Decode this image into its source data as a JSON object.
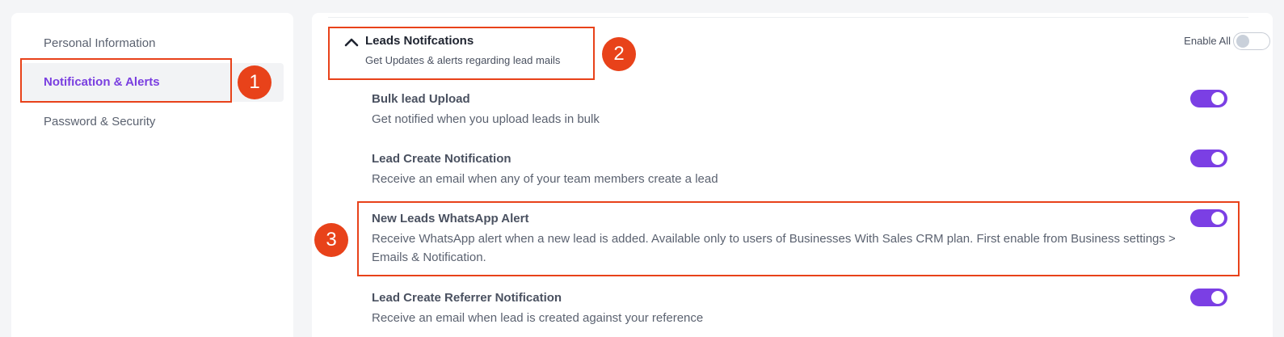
{
  "sidebar": {
    "items": [
      {
        "label": "Personal Information"
      },
      {
        "label": "Notification & Alerts"
      },
      {
        "label": "Password & Security"
      }
    ]
  },
  "group": {
    "title": "Leads Notifcations",
    "subtitle": "Get Updates & alerts regarding lead mails",
    "enable_all_label": "Enable All",
    "enable_all_on": false
  },
  "notifications": [
    {
      "title": "Bulk lead Upload",
      "desc": "Get notified when you upload leads in bulk",
      "on": true
    },
    {
      "title": "Lead Create Notification",
      "desc": "Receive an email when any of your team members create a lead",
      "on": true
    },
    {
      "title": "New Leads WhatsApp Alert",
      "desc": "Receive WhatsApp alert when a new lead is added. Available only to users of Businesses With Sales CRM plan. First enable from Business settings > Emails & Notification.",
      "on": true
    },
    {
      "title": "Lead Create Referrer Notification",
      "desc": "Receive an email when lead is created against your reference",
      "on": true
    }
  ],
  "annotations": [
    "1",
    "2",
    "3"
  ],
  "colors": {
    "accent": "#7b3fe4",
    "annotation": "#e8421a"
  }
}
